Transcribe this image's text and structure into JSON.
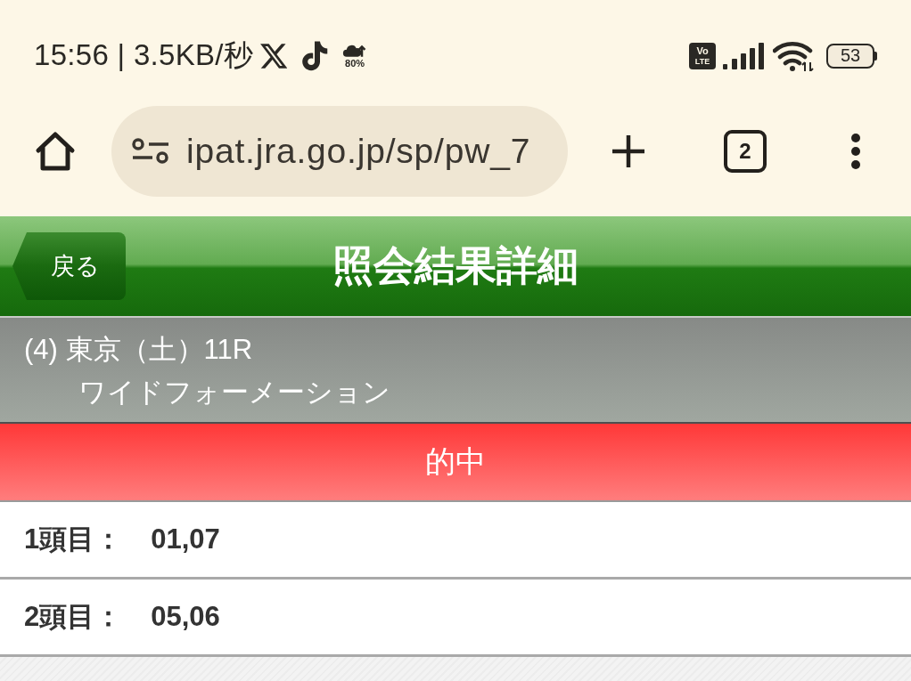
{
  "status_bar": {
    "time_and_speed": "15:56 | 3.5KB/秒",
    "weather_percent": "80%",
    "volte_badge": {
      "top": "Vo",
      "bottom": "LTE"
    },
    "battery": "53"
  },
  "browser": {
    "url": "ipat.jra.go.jp/sp/pw_7",
    "tab_count": "2"
  },
  "header": {
    "back_label": "戻る",
    "title": "照会結果詳細"
  },
  "race": {
    "line_1": "(4) 東京（土）11R",
    "line_2": "ワイドフォーメーション"
  },
  "result": {
    "label": "的中"
  },
  "selections": [
    {
      "label": "1頭目：",
      "value": "01,07"
    },
    {
      "label": "2頭目：",
      "value": "05,06"
    }
  ]
}
